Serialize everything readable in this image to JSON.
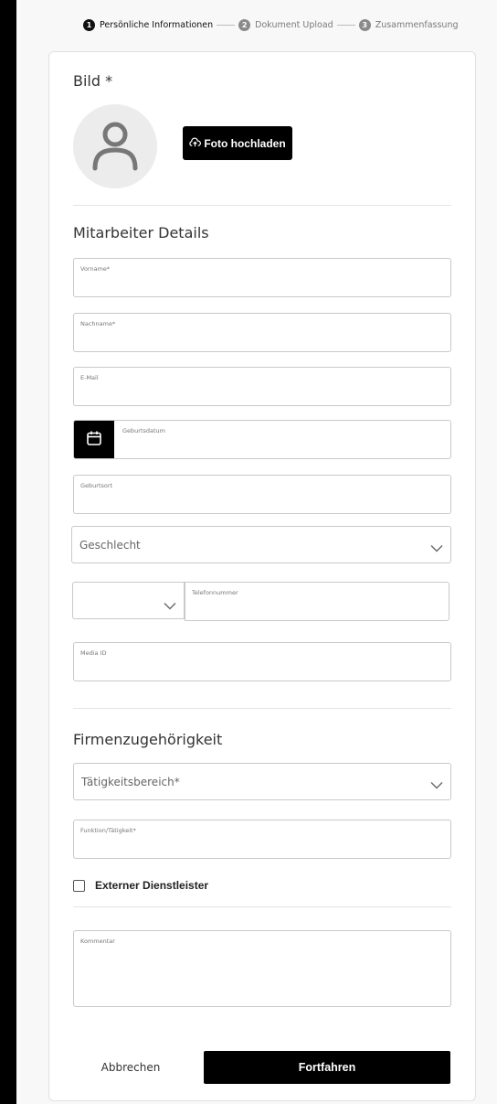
{
  "stepper": {
    "steps": [
      {
        "num": "1",
        "label": "Persönliche Informationen"
      },
      {
        "num": "2",
        "label": "Dokument Upload"
      },
      {
        "num": "3",
        "label": "Zusammenfassung"
      }
    ],
    "active_step": 1
  },
  "photo_section": {
    "title": "Bild *",
    "upload_label": "Foto hochladen"
  },
  "details_section": {
    "title": "Mitarbeiter Details",
    "fields": {
      "first_name": {
        "label": "Vorname*",
        "value": ""
      },
      "last_name": {
        "label": "Nachname*",
        "value": ""
      },
      "email": {
        "label": "E-Mail",
        "value": ""
      },
      "birth_date": {
        "label": "Geburtsdatum",
        "value": ""
      },
      "birth_place": {
        "label": "Geburtsort",
        "value": ""
      },
      "gender": {
        "placeholder": "Geschlecht"
      },
      "phone_code": {
        "value": ""
      },
      "phone": {
        "label": "Telefonnummer",
        "value": ""
      },
      "media_id": {
        "label": "Media ID",
        "value": ""
      }
    }
  },
  "company_section": {
    "title": "Firmenzugehörigkeit",
    "fields": {
      "area": {
        "placeholder": "Tätigkeitsbereich*"
      },
      "function": {
        "label": "Funktion/Tätigkeit*",
        "value": ""
      },
      "external": {
        "label": "Externer Dienstleister",
        "checked": false
      }
    }
  },
  "comment": {
    "label": "Kommentar",
    "value": ""
  },
  "actions": {
    "cancel_label": "Abbrechen",
    "submit_label": "Fortfahren"
  },
  "colors": {
    "primary": "#000000",
    "background": "#f8f8f8",
    "border": "#c9c9c9"
  },
  "icons": [
    "user-icon",
    "cloud-upload-icon",
    "calendar-icon",
    "chevron-down-icon"
  ]
}
